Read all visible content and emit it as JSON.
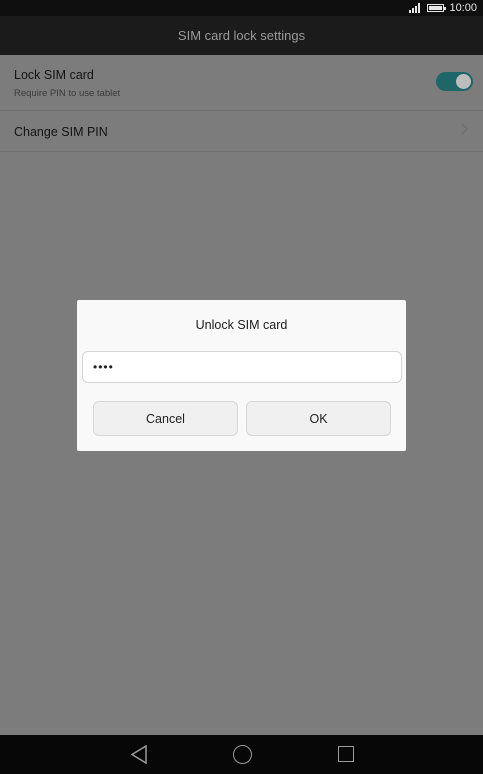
{
  "status_bar": {
    "time": "10:00",
    "signal_icon": "signal-icon",
    "battery_icon": "battery-icon"
  },
  "header": {
    "title": "SIM card lock settings"
  },
  "settings": {
    "lock_sim": {
      "title": "Lock SIM card",
      "subtitle": "Require PIN to use tablet",
      "toggle_on": true,
      "accent": "#1e6668"
    },
    "change_pin": {
      "title": "Change SIM PIN",
      "icon": "chevron-right-icon"
    }
  },
  "dialog": {
    "title": "Unlock SIM card",
    "pin_value": "••••",
    "cancel_label": "Cancel",
    "ok_label": "OK"
  },
  "nav_bar": {
    "back_icon": "back-icon",
    "home_icon": "home-icon",
    "recents_icon": "recents-icon"
  },
  "colors": {
    "scrim": "#7c7c7c",
    "title_bar": "#1b1b1b",
    "dialog_bg": "#f9f9f9"
  }
}
